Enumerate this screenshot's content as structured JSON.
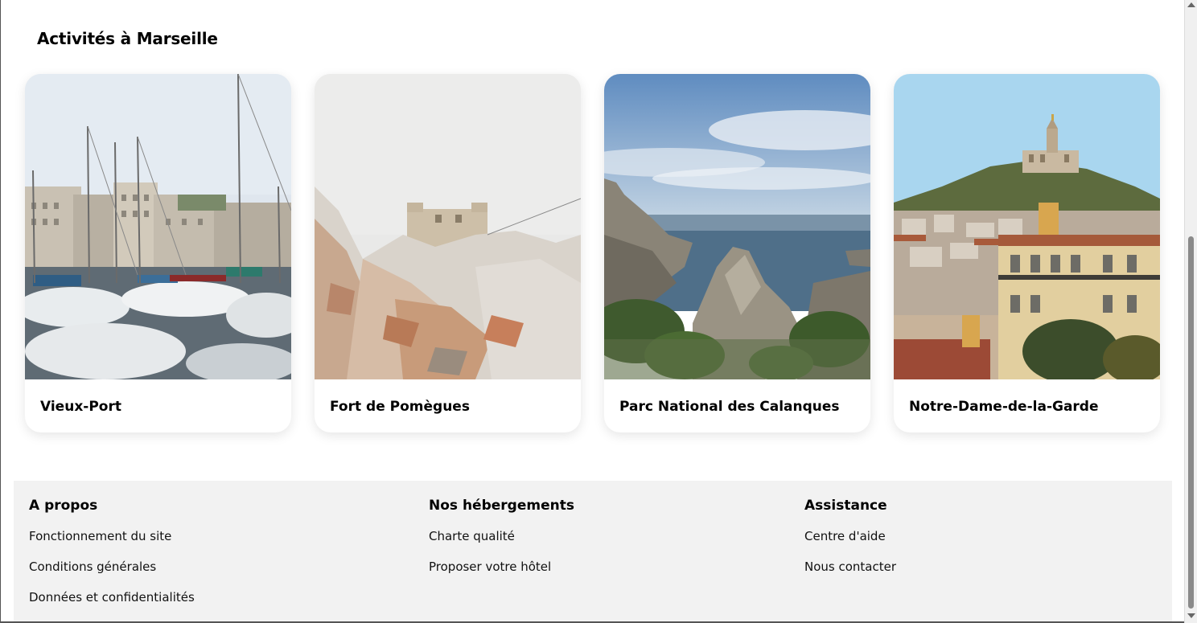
{
  "activities": {
    "title": "Activités à Marseille",
    "cards": [
      {
        "label": "Vieux-Port",
        "image": "marina-with-sailboats"
      },
      {
        "label": "Fort de Pomègues",
        "image": "fort-on-rocky-island"
      },
      {
        "label": "Parc National des Calanques",
        "image": "cliffs-and-sea"
      },
      {
        "label": "Notre-Dame-de-la-Garde",
        "image": "basilica-on-hill"
      }
    ]
  },
  "footer": {
    "columns": [
      {
        "title": "A propos",
        "links": [
          "Fonctionnement du site",
          "Conditions générales",
          "Données et confidentialités"
        ]
      },
      {
        "title": "Nos hébergements",
        "links": [
          "Charte qualité",
          "Proposer votre hôtel"
        ]
      },
      {
        "title": "Assistance",
        "links": [
          "Centre d'aide",
          "Nous contacter"
        ]
      }
    ]
  },
  "colors": {
    "footer_bg": "#f2f2f2",
    "text": "#000000"
  }
}
